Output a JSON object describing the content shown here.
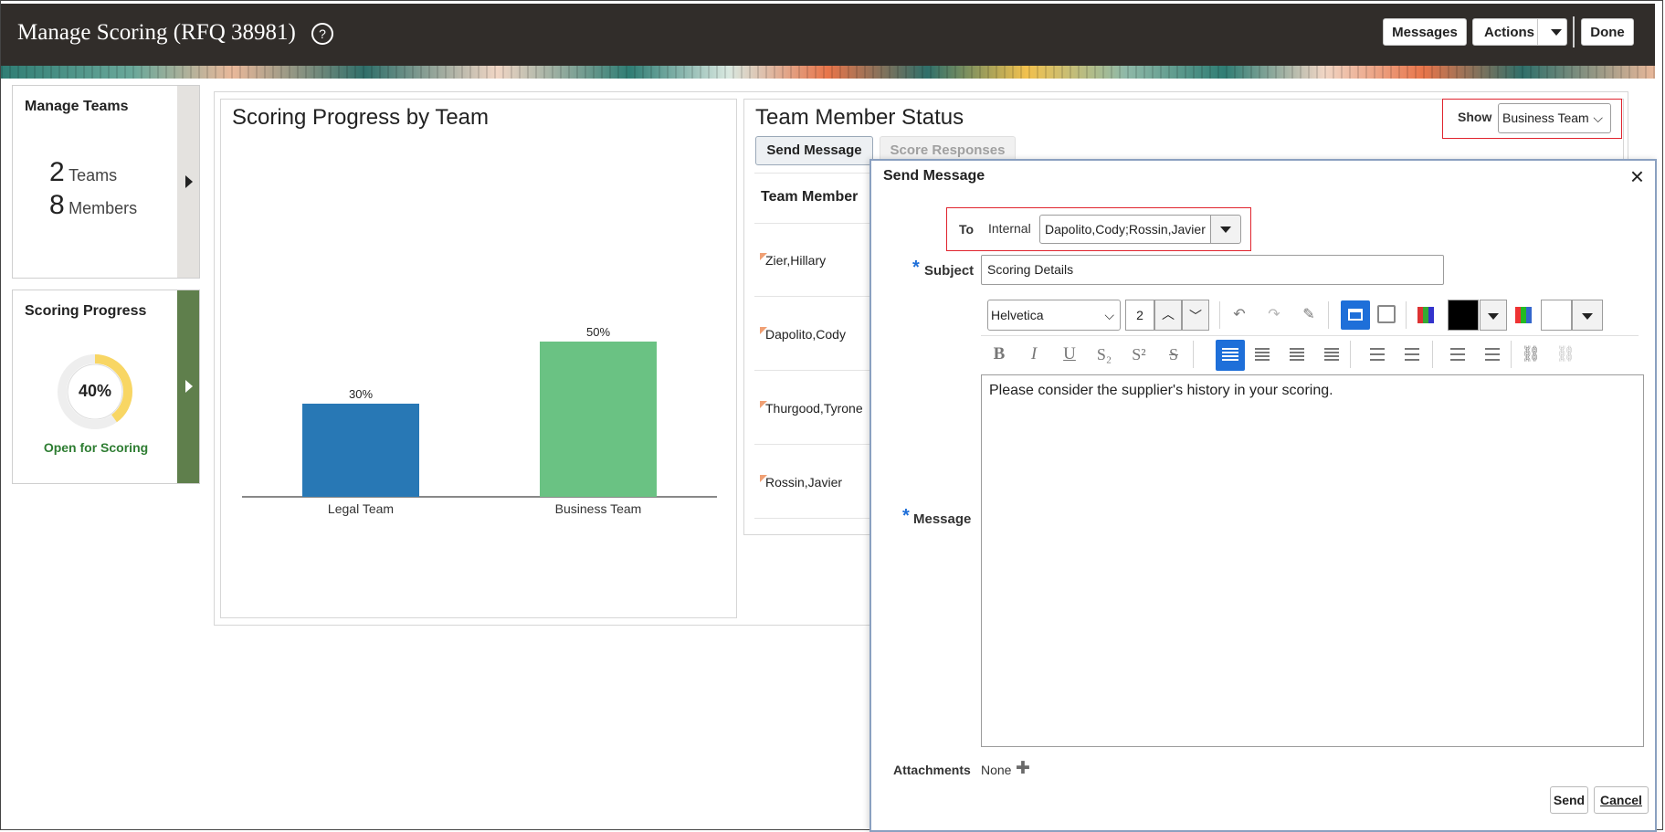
{
  "header": {
    "title": "Manage Scoring (RFQ 38981)",
    "help_glyph": "?",
    "messages_label": "Messages",
    "actions_label": "Actions",
    "done_label": "Done"
  },
  "manage_teams": {
    "title": "Manage Teams",
    "teams_count": "2",
    "teams_label": "Teams",
    "members_count": "8",
    "members_label": "Members"
  },
  "scoring_progress": {
    "title": "Scoring Progress",
    "percent_label": "40%",
    "percent_value": 0.4,
    "status": "Open for Scoring",
    "ring_color": "#f8d664",
    "status_color": "#2e7d32"
  },
  "chart_panel": {
    "title": "Scoring Progress by Team"
  },
  "chart_data": {
    "type": "bar",
    "title": "Scoring Progress by Team",
    "categories": [
      "Legal Team",
      "Business Team"
    ],
    "values": [
      30,
      50
    ],
    "value_labels": [
      "30%",
      "50%"
    ],
    "colors": [
      "#2878b5",
      "#6ac283"
    ],
    "ylim": [
      0,
      100
    ],
    "grid": false,
    "xlabel": "",
    "ylabel": ""
  },
  "team_member_status": {
    "title": "Team Member Status",
    "show_label": "Show",
    "show_value": "Business Team",
    "send_message_tab": "Send Message",
    "score_responses_tab": "Score Responses",
    "column_header": "Team Member",
    "members": [
      "Zier,Hillary",
      "Dapolito,Cody",
      "Thurgood,Tyrone",
      "Rossin,Javier"
    ]
  },
  "dialog": {
    "title": "Send Message",
    "close_glyph": "×",
    "to_label": "To",
    "to_type": "Internal",
    "to_value": "Dapolito,Cody;Rossin,Javier",
    "subject_label": "Subject",
    "subject_value": "Scoring Details",
    "font_family": "Helvetica",
    "font_size": "2",
    "message_label": "Message",
    "message_body": "Please consider the supplier's history in your scoring.",
    "attachments_label": "Attachments",
    "attachments_value": "None",
    "send_label": "Send",
    "cancel_label": "Cancel",
    "required_mark": "*",
    "toolbar": {
      "bold": "B",
      "italic": "I",
      "underline": "U",
      "subscript": "S₂",
      "superscript": "S²",
      "strike": "S",
      "undo": "↶",
      "redo": "↷",
      "eraser": "✎",
      "plus": "✚"
    },
    "text_color": "#000000",
    "bg_color": "#ffffff",
    "accent": "#1e6fd9"
  }
}
